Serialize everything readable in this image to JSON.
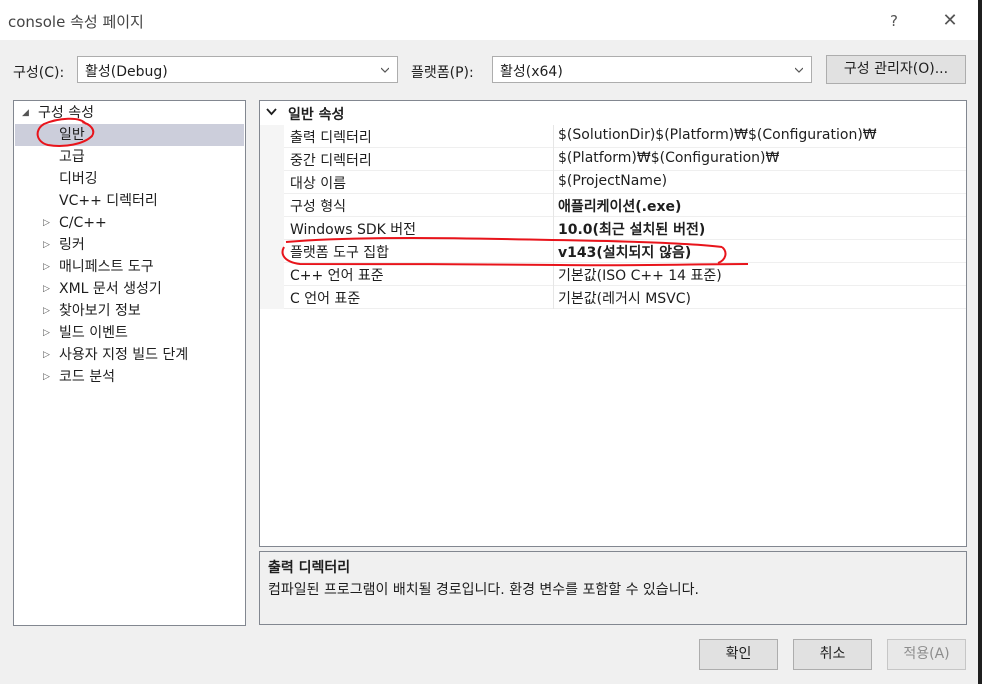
{
  "window": {
    "title": "console 속성 페이지",
    "help_label": "?",
    "close_label": "✕"
  },
  "toolbar": {
    "config_label": "구성(C):",
    "config_value": "활성(Debug)",
    "platform_label": "플랫폼(P):",
    "platform_value": "활성(x64)",
    "config_manager_label": "구성 관리자(O)..."
  },
  "tree": {
    "root": "구성 속성",
    "items": [
      {
        "label": "일반",
        "selected": true,
        "expandable": false
      },
      {
        "label": "고급",
        "expandable": false
      },
      {
        "label": "디버깅",
        "expandable": false
      },
      {
        "label": "VC++ 디렉터리",
        "expandable": false
      },
      {
        "label": "C/C++",
        "expandable": true
      },
      {
        "label": "링커",
        "expandable": true
      },
      {
        "label": "매니페스트 도구",
        "expandable": true
      },
      {
        "label": "XML 문서 생성기",
        "expandable": true
      },
      {
        "label": "찾아보기 정보",
        "expandable": true
      },
      {
        "label": "빌드 이벤트",
        "expandable": true
      },
      {
        "label": "사용자 지정 빌드 단계",
        "expandable": true
      },
      {
        "label": "코드 분석",
        "expandable": true
      }
    ]
  },
  "grid": {
    "category": "일반 속성",
    "properties": [
      {
        "name": "출력 디렉터리",
        "value": "$(SolutionDir)$(Platform)₩$(Configuration)₩",
        "bold": false
      },
      {
        "name": "중간 디렉터리",
        "value": "$(Platform)₩$(Configuration)₩",
        "bold": false
      },
      {
        "name": "대상 이름",
        "value": "$(ProjectName)",
        "bold": false
      },
      {
        "name": "구성 형식",
        "value": "애플리케이션(.exe)",
        "bold": true
      },
      {
        "name": "Windows SDK 버전",
        "value": "10.0(최근 설치된 버전)",
        "bold": true
      },
      {
        "name": "플랫폼 도구 집합",
        "value": "v143(설치되지 않음)",
        "bold": true
      },
      {
        "name": "C++ 언어 표준",
        "value": "기본값(ISO C++ 14 표준)",
        "bold": false
      },
      {
        "name": "C 언어 표준",
        "value": "기본값(레거시 MSVC)",
        "bold": false
      }
    ]
  },
  "description": {
    "title": "출력 디렉터리",
    "text": "컴파일된 프로그램이 배치될 경로입니다. 환경 변수를 포함할 수 있습니다."
  },
  "buttons": {
    "ok": "확인",
    "cancel": "취소",
    "apply": "적용(A)"
  },
  "colors": {
    "selection": "#cccedb",
    "annotation": "#e8141b"
  }
}
